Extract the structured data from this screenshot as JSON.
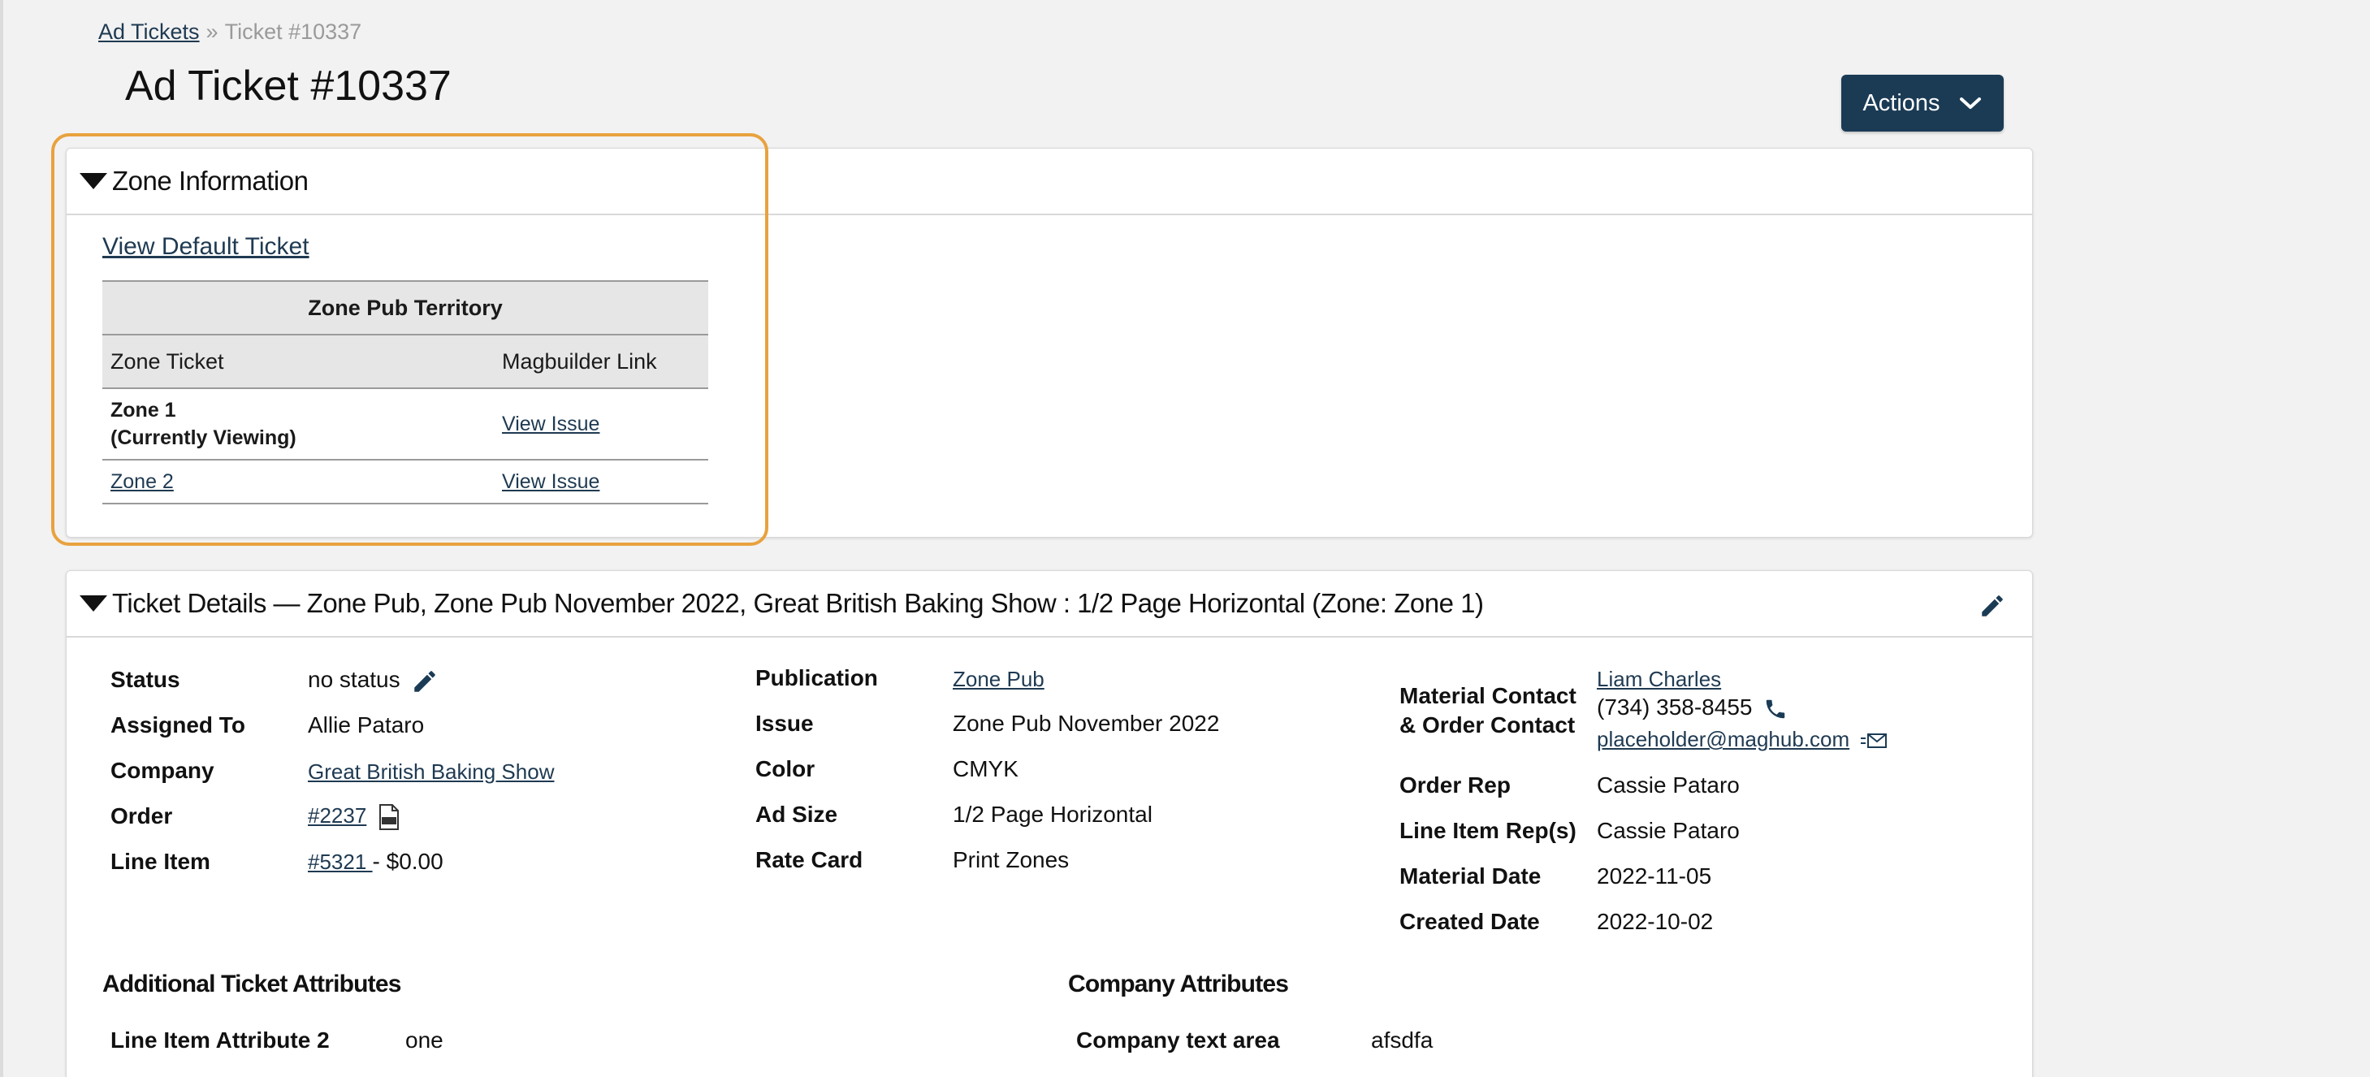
{
  "breadcrumb": {
    "parent": "Ad Tickets",
    "separator": "»",
    "current": "Ticket #10337"
  },
  "page_title": "Ad Ticket #10337",
  "actions_label": "Actions",
  "zone_panel": {
    "title": "Zone Information",
    "view_default_link": "View Default Ticket",
    "table": {
      "group_header": "Zone Pub Territory",
      "columns": [
        "Zone Ticket",
        "Magbuilder Link"
      ],
      "rows": [
        {
          "zone": "Zone 1",
          "note": "(Currently Viewing)",
          "link": "View Issue"
        },
        {
          "zone": "Zone 2",
          "link": "View Issue"
        }
      ]
    }
  },
  "details_panel": {
    "title": "Ticket Details — Zone Pub, Zone Pub November 2022, Great British Baking Show : 1/2 Page Horizontal (Zone: Zone 1)",
    "col1": {
      "status_label": "Status",
      "status_value": "no status",
      "assigned_label": "Assigned To",
      "assigned_value": "Allie Pataro",
      "company_label": "Company",
      "company_value": "Great British Baking Show",
      "order_label": "Order",
      "order_value": "#2237",
      "lineitem_label": "Line Item",
      "lineitem_value": "#5321 ",
      "lineitem_price": "- $0.00"
    },
    "col2": {
      "publication_label": "Publication",
      "publication_value": "Zone Pub",
      "issue_label": "Issue",
      "issue_value": "Zone Pub November 2022",
      "color_label": "Color",
      "color_value": "CMYK",
      "adsize_label": "Ad Size",
      "adsize_value": "1/2 Page Horizontal",
      "ratecard_label": "Rate Card",
      "ratecard_value": "Print Zones"
    },
    "col3": {
      "contact_label_1": "Material Contact",
      "contact_label_2": "& Order Contact",
      "contact_name": "Liam Charles",
      "contact_phone": "(734) 358-8455",
      "contact_email": "placeholder@maghub.com",
      "orderrep_label": "Order Rep",
      "orderrep_value": "Cassie Pataro",
      "lirep_label": "Line Item Rep(s)",
      "lirep_value": "Cassie Pataro",
      "matdate_label": "Material Date",
      "matdate_value": "2022-11-05",
      "created_label": "Created Date",
      "created_value": "2022-10-02"
    },
    "additional_title": "Additional Ticket Attributes",
    "additional_attr_label": "Line Item Attribute 2",
    "additional_attr_value": "one",
    "company_title": "Company Attributes",
    "company_attr_label": "Company text area",
    "company_attr_value": "afsdfa"
  },
  "colors": {
    "accent": "#1b3b55",
    "highlight": "#e8a23e",
    "link": "#1f3a52"
  }
}
